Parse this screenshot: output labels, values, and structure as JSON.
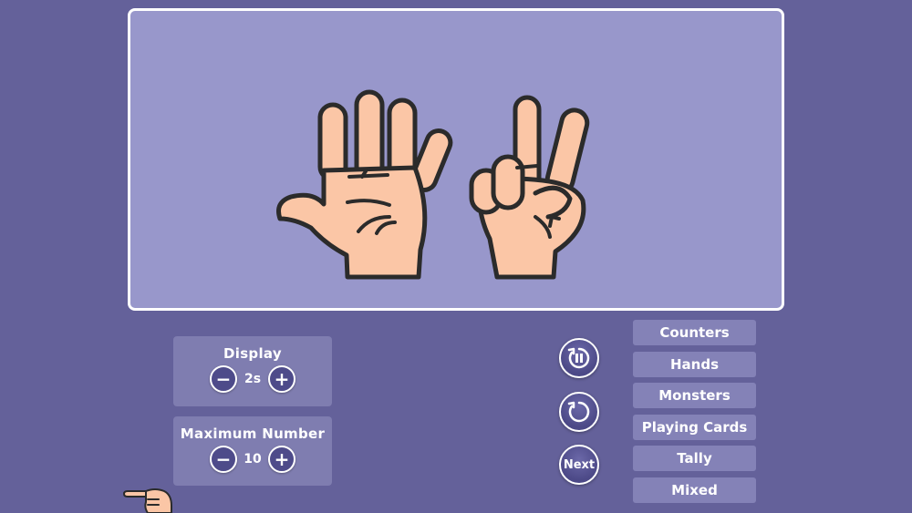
{
  "display_panel": {
    "title": "Display",
    "minus": "−",
    "value": "2s",
    "plus": "+"
  },
  "max_panel": {
    "title": "Maximum Number",
    "minus": "−",
    "value": "10",
    "plus": "+"
  },
  "controls": {
    "next_label": "Next"
  },
  "modes": [
    "Counters",
    "Hands",
    "Monsters",
    "Playing Cards",
    "Tally",
    "Mixed"
  ],
  "scene": {
    "fingers_shown": 7,
    "left_hand_fingers": 5,
    "right_hand_fingers": 2
  },
  "colors": {
    "background": "#64619a",
    "display_area": "#9897cb",
    "panel": "#7f7db0",
    "mode_button": "#8482b7",
    "skin": "#fbc6a6",
    "outline": "#2b2b2b"
  }
}
